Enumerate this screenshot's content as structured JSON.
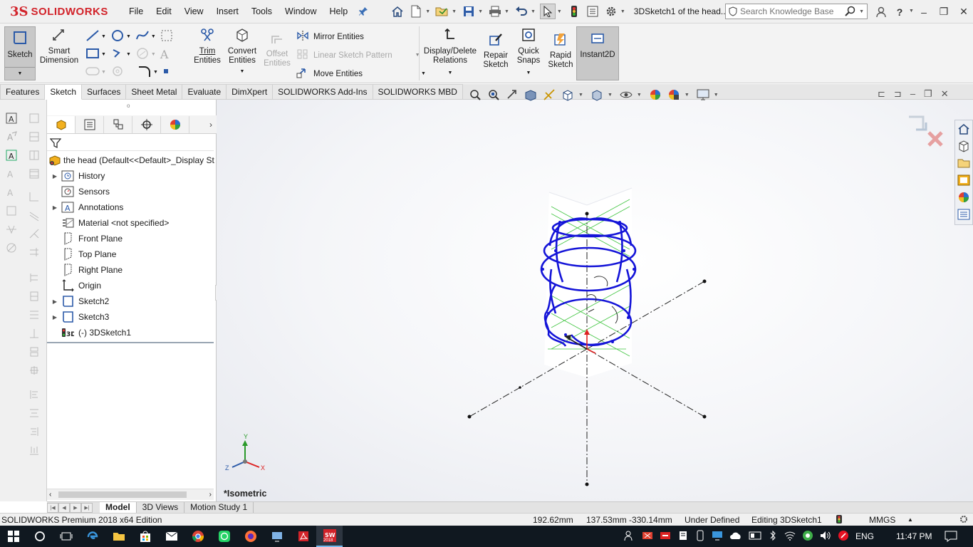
{
  "app": {
    "brand_ds": "3S",
    "brand_name": "SOLIDWORKS",
    "doc_title": "3DSketch1 of the head..."
  },
  "menu": [
    "File",
    "Edit",
    "View",
    "Insert",
    "Tools",
    "Window",
    "Help"
  ],
  "search": {
    "placeholder": "Search Knowledge Base"
  },
  "ribbon": {
    "sketch": "Sketch",
    "smart_dimension": [
      "Smart",
      "Dimension"
    ],
    "trim_entities": [
      "Trim",
      "Entities"
    ],
    "convert_entities": [
      "Convert",
      "Entities"
    ],
    "offset_entities": [
      "Offset",
      "Entities"
    ],
    "mirror_entities": "Mirror Entities",
    "linear_sketch_pattern": "Linear Sketch Pattern",
    "move_entities": "Move Entities",
    "display_delete_relations": [
      "Display/Delete",
      "Relations"
    ],
    "repair_sketch": [
      "Repair",
      "Sketch"
    ],
    "quick_snaps": [
      "Quick",
      "Snaps"
    ],
    "rapid_sketch": [
      "Rapid",
      "Sketch"
    ],
    "instant2d": "Instant2D"
  },
  "cm_tabs": [
    "Features",
    "Sketch",
    "Surfaces",
    "Sheet Metal",
    "Evaluate",
    "DimXpert",
    "SOLIDWORKS Add-Ins",
    "SOLIDWORKS MBD"
  ],
  "cm_active_tab": "Sketch",
  "feature_tree": {
    "root": "the head  (Default<<Default>_Display St",
    "items": [
      {
        "label": "History",
        "expandable": true,
        "icon": "history-icon"
      },
      {
        "label": "Sensors",
        "expandable": false,
        "icon": "sensors-icon"
      },
      {
        "label": "Annotations",
        "expandable": true,
        "icon": "annotations-icon"
      },
      {
        "label": "Material <not specified>",
        "expandable": false,
        "icon": "material-icon"
      },
      {
        "label": "Front Plane",
        "expandable": false,
        "icon": "plane-icon"
      },
      {
        "label": "Top Plane",
        "expandable": false,
        "icon": "plane-icon"
      },
      {
        "label": "Right Plane",
        "expandable": false,
        "icon": "plane-icon"
      },
      {
        "label": "Origin",
        "expandable": false,
        "icon": "origin-icon"
      },
      {
        "label": "Sketch2",
        "expandable": true,
        "icon": "sketch-icon"
      },
      {
        "label": "Sketch3",
        "expandable": true,
        "icon": "sketch-icon"
      },
      {
        "label": "(-) 3DSketch1",
        "expandable": false,
        "icon": "3dsketch-icon"
      }
    ]
  },
  "viewport": {
    "view_name": "*Isometric",
    "triad_labels": {
      "x": "X",
      "y": "Y",
      "z": "Z"
    }
  },
  "bottom_tabs": [
    "Model",
    "3D Views",
    "Motion Study 1"
  ],
  "bottom_active_tab": "Model",
  "status": {
    "edition": "SOLIDWORKS Premium 2018 x64 Edition",
    "length": "192.62mm",
    "coords": "137.53mm -330.14mm",
    "definition": "Under Defined",
    "editing": "Editing 3DSketch1",
    "units": "MMGS"
  },
  "taskbar": {
    "language": "ENG",
    "time": "11:47 PM",
    "sw_badge": "2018"
  },
  "colors": {
    "brand_red": "#d2232a",
    "sketch_blue": "#1414d8",
    "sketch_green": "#2fbf2f",
    "taskbar_bg": "#101820"
  }
}
